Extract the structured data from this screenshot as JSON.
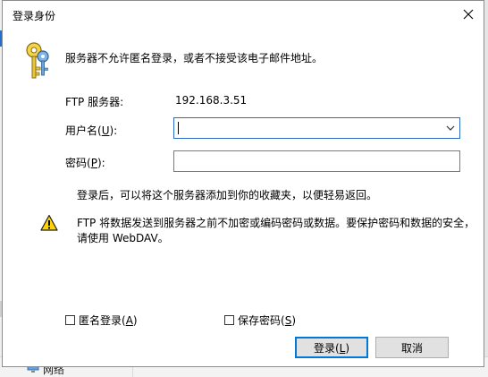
{
  "background": {
    "bottom_item_label": "网络"
  },
  "dialog": {
    "title": "登录身份",
    "info": "服务器不允许匿名登录，或者不接受该电子邮件地址。",
    "ftp_server_label": "FTP 服务器:",
    "ftp_server_value": "192.168.3.51",
    "username_label_prefix": "用户名(",
    "username_label_key": "U",
    "username_label_suffix": "):",
    "username_value": "",
    "password_label_prefix": "密码(",
    "password_label_key": "P",
    "password_label_suffix": "):",
    "password_value": "",
    "note": "登录后，可以将这个服务器添加到你的收藏夹，以便轻易返回。",
    "warning": "FTP 将数据发送到服务器之前不加密或编码密码或数据。要保护密码和数据的安全，请使用 WebDAV。",
    "anonymous_label_prefix": "匿名登录(",
    "anonymous_label_key": "A",
    "anonymous_label_suffix": ")",
    "save_password_label_prefix": "保存密码(",
    "save_password_label_key": "S",
    "save_password_label_suffix": ")",
    "login_label_prefix": "登录(",
    "login_label_key": "L",
    "login_label_suffix": ")",
    "cancel_label": "取消"
  },
  "icons": {
    "close": "close-icon",
    "keys": "keys-icon",
    "warning": "warning-icon",
    "dropdown": "chevron-down-icon"
  },
  "colors": {
    "focus_border": "#2d6bc8",
    "default_button_border": "#0078d7",
    "warning_yellow": "#ffd400"
  }
}
